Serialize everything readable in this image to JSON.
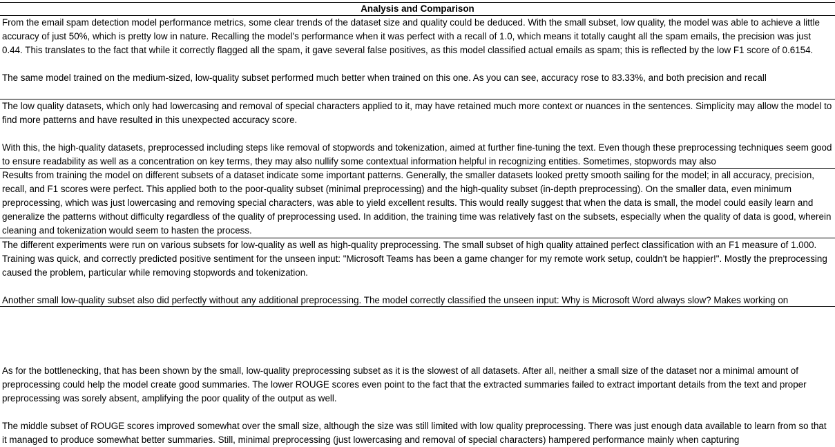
{
  "sheet": {
    "title": "Analysis and Comparison",
    "cells": [
      "From the email spam detection model performance metrics, some clear trends of the dataset size and quality could be deduced. With the small subset, low quality, the model was able to achieve a little accuracy of just 50%, which is pretty low in nature. Recalling the model's performance when it was perfect with a recall of 1.0, which means it totally caught all the spam emails, the precision was just 0.44. This translates to the fact that while it correctly flagged all the spam, it gave several false positives, as this model classified actual emails as spam; this is reflected by the low F1 score of 0.6154.\n\nThe same model trained on the medium-sized, low-quality subset performed much better when trained on this one. As you can see, accuracy rose to 83.33%, and both precision and recall",
      "The low quality datasets, which only had lowercasing and removal of special characters applied to it, may have retained much more context or nuances in the sentences. Simplicity may allow the model to find more patterns and have resulted in this unexpected accuracy score.\n\nWith this, the high-quality datasets, preprocessed including steps like removal of stopwords and tokenization, aimed at further fine-tuning the text. Even though these preprocessing techniques seem good to ensure readability as well as a concentration on key terms, they may also nullify some contextual information helpful in recognizing entities. Sometimes, stopwords may also",
      "Results from training the model on different subsets of a dataset indicate some important patterns. Generally, the smaller datasets looked pretty smooth sailing for the model; in all accuracy, precision, recall, and F1 scores were perfect. This applied both to the poor-quality subset (minimal preprocessing) and the high-quality subset (in-depth preprocessing). On the smaller data, even minimum preprocessing, which was just lowercasing and removing special characters, was able to yield excellent results. This would really suggest that when the data is small, the model could easily learn and generalize the patterns without difficulty regardless of the quality of preprocessing used. In addition, the training time was relatively fast on the subsets, especially when the quality of data is good, wherein cleaning and tokenization would seem to hasten the process.",
      "The different experiments were run on various subsets for low-quality as well as high-quality preprocessing. The small subset of high quality attained perfect classification with an F1 measure of 1.000. Training was quick, and correctly predicted positive sentiment for the unseen input: \"Microsoft Teams has been a game changer for my remote work setup, couldn't be happier!\". Mostly the preprocessing caused the problem, particular while removing stopwords and tokenization.\n\nAnother small low-quality subset also did perfectly without any additional preprocessing. The model correctly classified the unseen input: Why is Microsoft Word always slow? Makes working on",
      "",
      "As for the bottlenecking, that has been shown by the small, low-quality preprocessing subset as it is the slowest of all datasets. After all, neither a small size of the dataset nor a minimal amount of preprocessing could help the model create good summaries. The lower ROUGE scores even point to the fact that the extracted summaries failed to extract important details from the text and proper preprocessing was sorely absent, amplifying the poor quality of the output as well.\n\nThe middle subset of ROUGE scores improved somewhat over the small size, although the size was still limited with low quality preprocessing. There was just enough data available to learn from so that it managed to produce somewhat better summaries. Still, minimal preprocessing (just lowercasing and removal of special characters) hampered performance mainly when capturing"
    ]
  }
}
